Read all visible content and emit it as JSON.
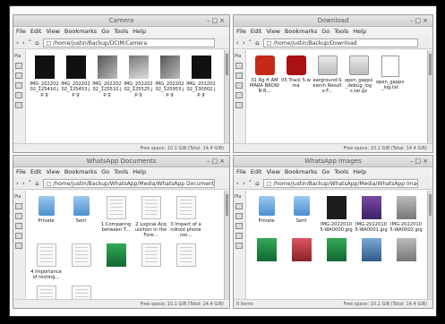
{
  "menu": [
    "File",
    "Edit",
    "View",
    "Bookmarks",
    "Go",
    "Tools",
    "Help"
  ],
  "windows": [
    {
      "title": "Camera",
      "path": "/home/justin/Backup/DCIM/Camera",
      "status": "Free space: 10.1 GiB (Total: 14.4 GiB)",
      "files": [
        {
          "name": "IMG_202202 02_125410.jp g",
          "icon": "photo-dark"
        },
        {
          "name": "IMG_202202 02_125453.jp g",
          "icon": "photo-dark"
        },
        {
          "name": "IMG_202202 02_125510.jp g",
          "icon": "photo-mid"
        },
        {
          "name": "IMG_202202 02_125525.jp g",
          "icon": "photo-mid2"
        },
        {
          "name": "IMG_202202 02_125953.jp g",
          "icon": "photo-mid"
        },
        {
          "name": "IMG_202202 02_130002.jp g",
          "icon": "photo-dark"
        }
      ]
    },
    {
      "title": "Download",
      "path": "/home/justin/Backup/Download",
      "status": "Free space: 10.1 GiB (Total: 14.4 GiB)",
      "files": [
        {
          "name": "01 Rg ft AMMARA BROWN B...",
          "icon": "vid"
        },
        {
          "name": "05 Track 5.wma",
          "icon": "vid2"
        },
        {
          "name": "earground-Search Results-F...",
          "icon": "arch"
        },
        {
          "name": "open_gapps _debug_log s.tar.gz",
          "icon": "arch"
        },
        {
          "name": "open_gapps _log.txt",
          "icon": "txt"
        }
      ]
    },
    {
      "title": "WhatsApp Documents",
      "path": "/home/justin/Backup/WhatsApp/Media/WhatsApp Documents",
      "status": "Free space: 10.1 GiB (Total: 14.4 GiB)",
      "files": [
        {
          "name": "Private",
          "icon": "folder"
        },
        {
          "name": "Sent",
          "icon": "folder"
        },
        {
          "name": "1 Comparing between T...",
          "icon": "doc"
        },
        {
          "name": "2 Logical Acquisition in the Fore...",
          "icon": "doc"
        },
        {
          "name": "3 Impact of android phone roo...",
          "icon": "doc"
        },
        {
          "name": "4 Importance of rooting...",
          "icon": "doc"
        },
        {
          "name": "",
          "icon": "doc"
        },
        {
          "name": "",
          "icon": "img-green"
        },
        {
          "name": "",
          "icon": "doc"
        },
        {
          "name": "",
          "icon": "doc"
        },
        {
          "name": "",
          "icon": "doc"
        },
        {
          "name": "",
          "icon": "doc"
        }
      ]
    },
    {
      "title": "WhatsApp Images",
      "path": "/home/justin/Backup/WhatsApp/Media/WhatsApp Images",
      "status": "Free space: 10.1 GiB (Total: 14.4 GiB)",
      "status_left": "0 items",
      "files": [
        {
          "name": "Private",
          "icon": "folder"
        },
        {
          "name": "Sent",
          "icon": "folder"
        },
        {
          "name": "IMG-2022010 5-WA0000.jpg",
          "icon": "img-dark"
        },
        {
          "name": "IMG-2022010 5-WA0001.jpg",
          "icon": "img-purple"
        },
        {
          "name": "IMG-2022010 5-WA0002.jpg",
          "icon": "img-gray"
        },
        {
          "name": "",
          "icon": "img-green"
        },
        {
          "name": "",
          "icon": "img-red"
        },
        {
          "name": "",
          "icon": "img-green"
        },
        {
          "name": "",
          "icon": "img-blue"
        },
        {
          "name": "",
          "icon": "img-gray"
        }
      ]
    }
  ]
}
